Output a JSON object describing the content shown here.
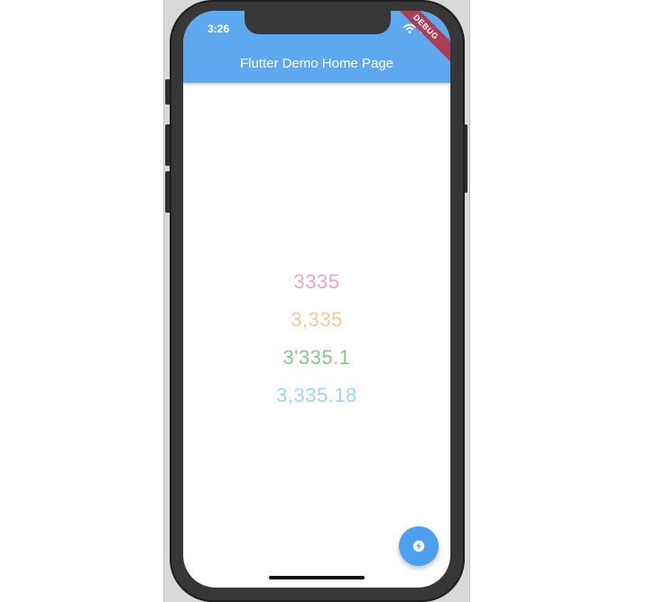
{
  "status_bar": {
    "time": "3:26",
    "wifi_icon": "wifi-icon",
    "battery_icon": "battery-icon"
  },
  "debug_banner": {
    "label": "DEBUG",
    "color": "#a8405a"
  },
  "appbar": {
    "title": "Flutter Demo Home Page",
    "color": "#5ea8f0"
  },
  "numbers": [
    {
      "text": "3335",
      "color": "#f2a3bd"
    },
    {
      "text": "3,335",
      "color": "#f6c79a"
    },
    {
      "text": "3'335.1",
      "color": "#86c78a"
    },
    {
      "text": "3,335.18",
      "color": "#9ed5ef"
    }
  ],
  "fab": {
    "icon": "flash-icon",
    "color": "#4d9ff0"
  }
}
